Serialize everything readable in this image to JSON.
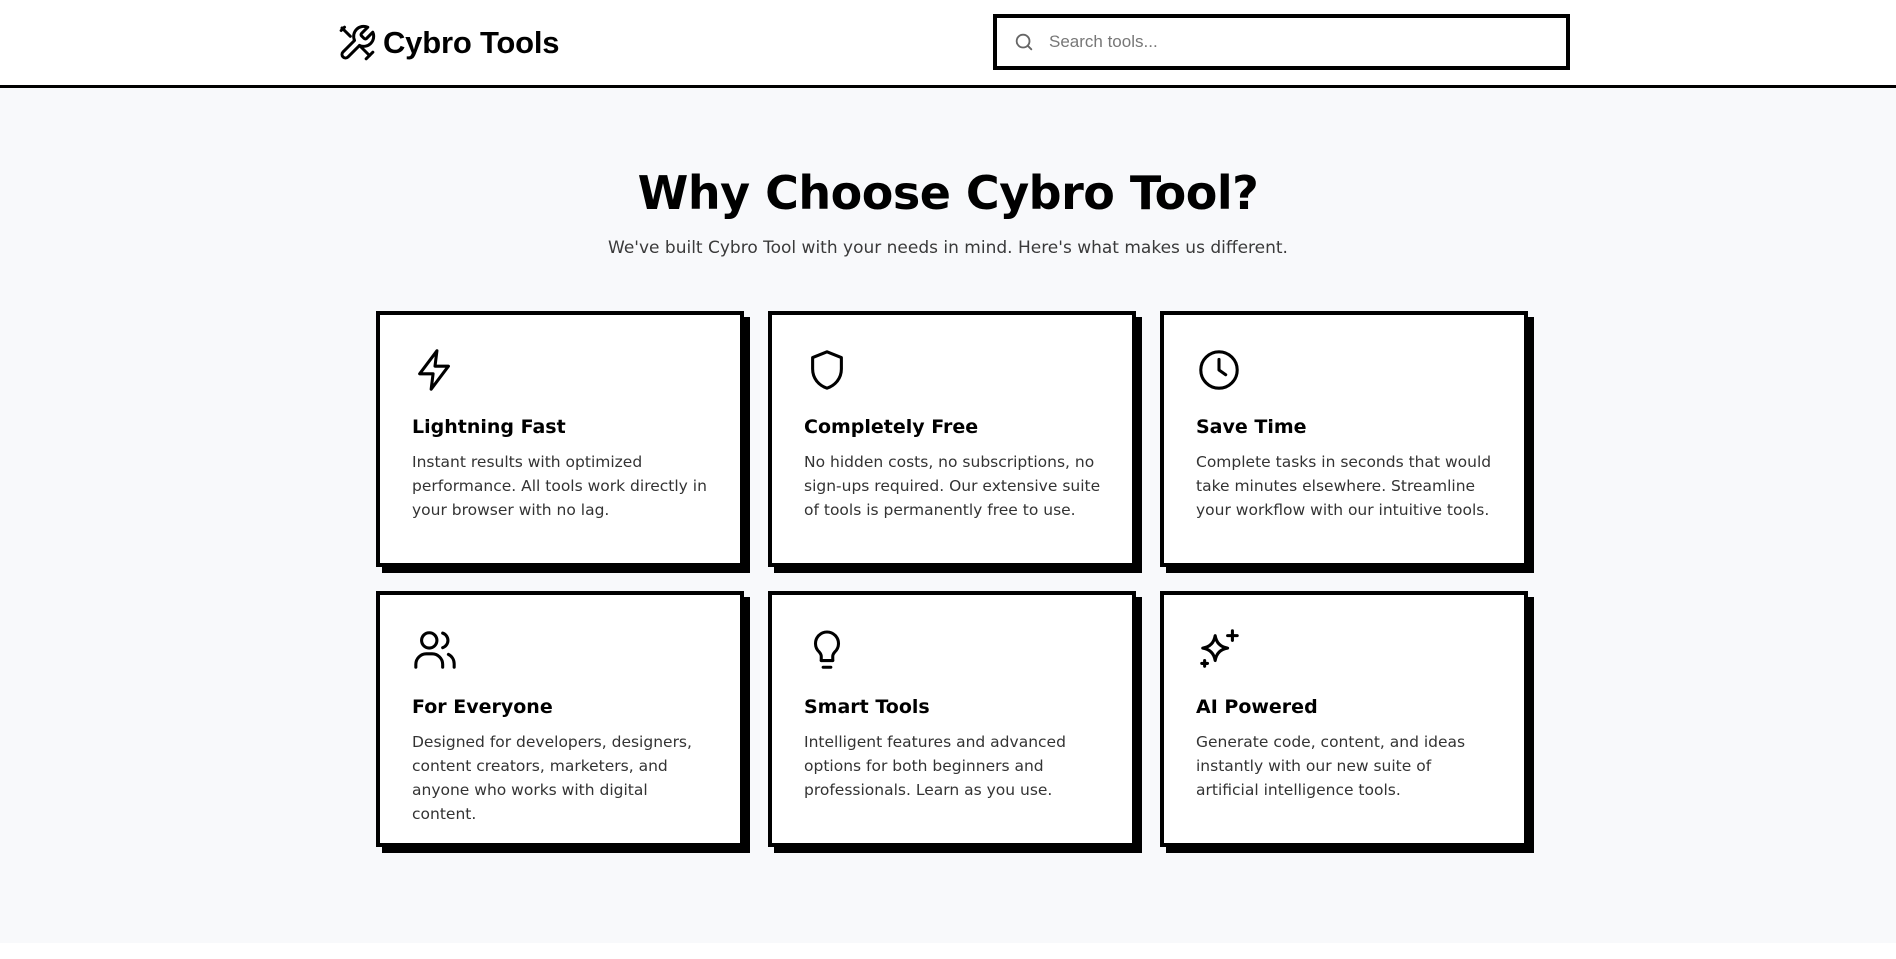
{
  "brand": {
    "name": "Cybro Tools",
    "logo_icon": "tools-icon"
  },
  "search": {
    "placeholder": "Search tools...",
    "value": "",
    "icon": "search-icon"
  },
  "hero": {
    "title": "Why Choose Cybro Tool?",
    "subtitle": "We've built Cybro Tool with your needs in mind. Here's what makes us different."
  },
  "features": [
    {
      "icon": "lightning-icon",
      "title": "Lightning Fast",
      "description": "Instant results with optimized performance. All tools work directly in your browser with no lag."
    },
    {
      "icon": "shield-icon",
      "title": "Completely Free",
      "description": "No hidden costs, no subscriptions, no sign-ups required. Our extensive suite of tools is permanently free to use."
    },
    {
      "icon": "clock-icon",
      "title": "Save Time",
      "description": "Complete tasks in seconds that would take minutes elsewhere. Streamline your workflow with our intuitive tools."
    },
    {
      "icon": "users-icon",
      "title": "For Everyone",
      "description": "Designed for developers, designers, content creators, marketers, and anyone who works with digital content."
    },
    {
      "icon": "lightbulb-icon",
      "title": "Smart Tools",
      "description": "Intelligent features and advanced options for both beginners and professionals. Learn as you use."
    },
    {
      "icon": "sparkles-icon",
      "title": "AI Powered",
      "description": "Generate code, content, and ideas instantly with our new suite of artificial intelligence tools."
    }
  ],
  "colors": {
    "border": "#000000",
    "page_background": "#f8f9fb",
    "card_background": "#ffffff",
    "body_text": "#333333"
  }
}
